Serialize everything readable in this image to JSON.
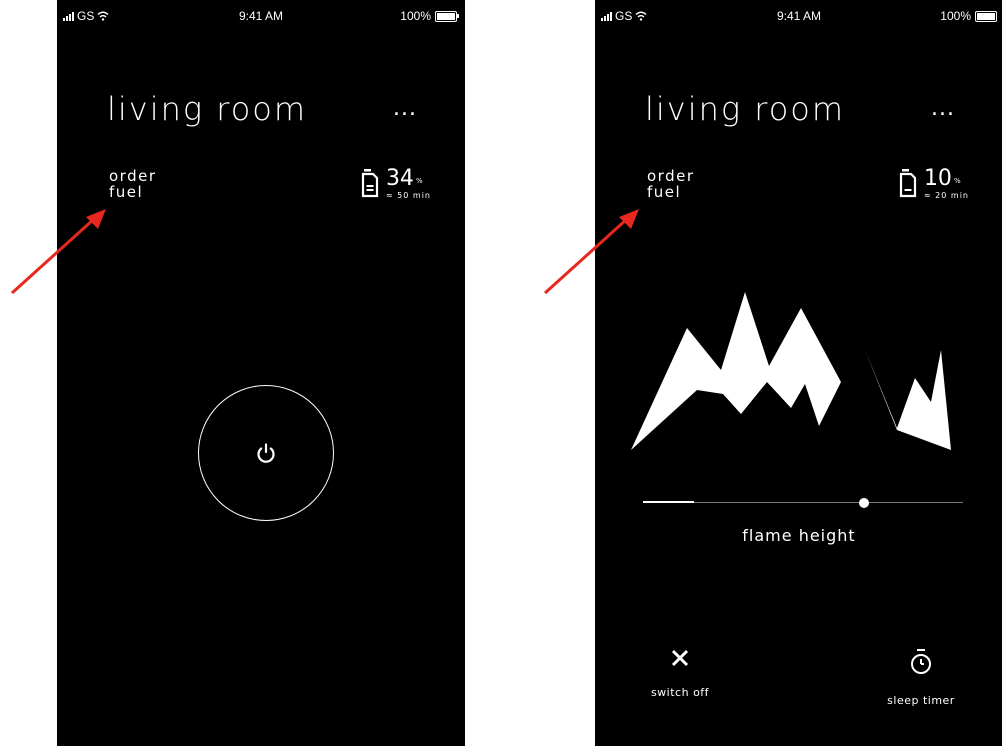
{
  "screens": [
    {
      "status": {
        "carrier": "GS",
        "time": "9:41 AM",
        "battery": "100%"
      },
      "title": "living room",
      "more": "...",
      "order": {
        "line1": "order",
        "line2": "fuel"
      },
      "fuel": {
        "value": "34",
        "unit": "%",
        "sub": "≈ 50 min"
      }
    },
    {
      "status": {
        "carrier": "GS",
        "time": "9:41 AM",
        "battery": "100%"
      },
      "title": "living room",
      "more": "...",
      "order": {
        "line1": "order",
        "line2": "fuel"
      },
      "fuel": {
        "value": "10",
        "unit": "%",
        "sub": "≈ 20 min"
      },
      "flame_label": "flame height",
      "slider_level_pct": 69,
      "switch_off_label": "switch off",
      "sleep_timer_label": "sleep timer"
    }
  ],
  "colors": {
    "background": "#000000",
    "foreground": "#ffffff",
    "annotation_arrow": "#e8281e"
  },
  "icons": [
    "signal-icon",
    "wifi-icon",
    "battery-icon",
    "fuel-can-icon",
    "power-icon",
    "flame-icon",
    "close-icon",
    "stopwatch-icon"
  ]
}
